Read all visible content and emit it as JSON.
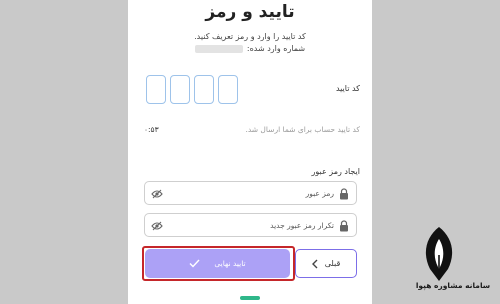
{
  "screen": {
    "title": "تایید و رمز",
    "instruction_line1": "کد تایید را وارد و رمز تعریف کنید.",
    "instruction_line2": "شماره وارد شده:"
  },
  "code": {
    "label": "کد تایید",
    "digits": [
      "",
      "",
      "",
      ""
    ],
    "resend_hint": "کد تایید حساب برای شما ارسال شد.",
    "timer": "۰:۵۳"
  },
  "password": {
    "section_label": "ایجاد رمز عبور",
    "field1_placeholder": "رمز عبور",
    "field2_placeholder": "تکرار رمز عبور جدید"
  },
  "actions": {
    "confirm_label": "تایید نهایی",
    "back_label": "قبلی"
  },
  "branding": {
    "site_name": "سامانه مشاوره هپوا"
  },
  "colors": {
    "primary": "#aca1f6",
    "accent_border": "#7c6ee8",
    "highlight": "#c5272a",
    "code_box_border": "#9ec3ea",
    "nav_indicator": "#2fb78a"
  }
}
